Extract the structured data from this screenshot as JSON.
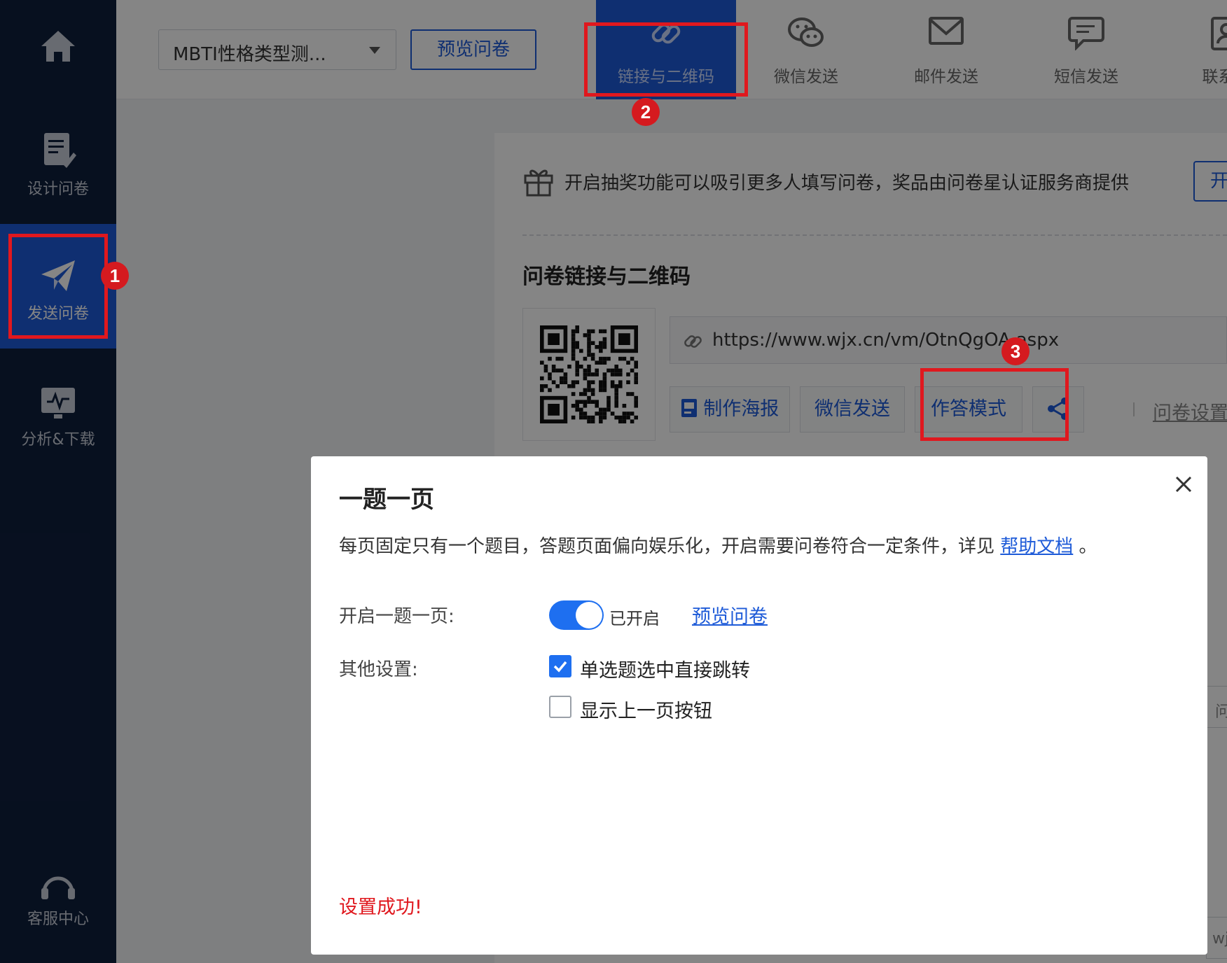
{
  "sidebar": {
    "items": [
      {
        "label": "",
        "icon": "home-icon"
      },
      {
        "label": "设计问卷",
        "icon": "edit-document-icon"
      },
      {
        "label": "发送问卷",
        "icon": "paper-plane-icon"
      },
      {
        "label": "分析&下载",
        "icon": "chart-monitor-icon"
      },
      {
        "label": "客服中心",
        "icon": "headset-icon"
      }
    ]
  },
  "topbar": {
    "survey_select": "MBTI性格类型测...",
    "preview_label": "预览问卷",
    "nav": [
      {
        "label": "链接与二维码",
        "icon": "link-icon"
      },
      {
        "label": "微信发送",
        "icon": "wechat-icon"
      },
      {
        "label": "邮件发送",
        "icon": "mail-icon"
      },
      {
        "label": "短信发送",
        "icon": "sms-icon"
      },
      {
        "label": "联系人",
        "icon": "contacts-icon"
      }
    ]
  },
  "content": {
    "lottery_text": "开启抽奖功能可以吸引更多人填写问卷，奖品由问卷星认证服务商提供",
    "lottery_button": "开",
    "section_title": "问卷链接与二维码",
    "url": "https://www.wjx.cn/vm/OtnQgOA.aspx",
    "actions": [
      "制作海报",
      "微信发送",
      "作答模式"
    ],
    "settings_link": "问卷设置",
    "peek_1": "问",
    "peek_2": "wj",
    "peek_3": "wj"
  },
  "annotations": {
    "badge_1": "1",
    "badge_2": "2",
    "badge_3": "3",
    "color": "#e0181e"
  },
  "dialog": {
    "title": "一题一页",
    "desc_prefix": "每页固定只有一个题目，答题页面偏向娱乐化，开启需要问卷符合一定条件，详见 ",
    "desc_link": "帮助文档",
    "desc_suffix": " 。",
    "toggle_label": "开启一题一页:",
    "toggle_state": "已开启",
    "toggle_preview": "预览问卷",
    "other_label": "其他设置:",
    "options": [
      {
        "label": "单选题选中直接跳转",
        "checked": true
      },
      {
        "label": "显示上一页按钮",
        "checked": false
      }
    ],
    "success_message": "设置成功!"
  },
  "colors": {
    "primary": "#1e5bd8",
    "sidebar_bg": "#0f1f3d",
    "success_text": "#e0181e"
  }
}
